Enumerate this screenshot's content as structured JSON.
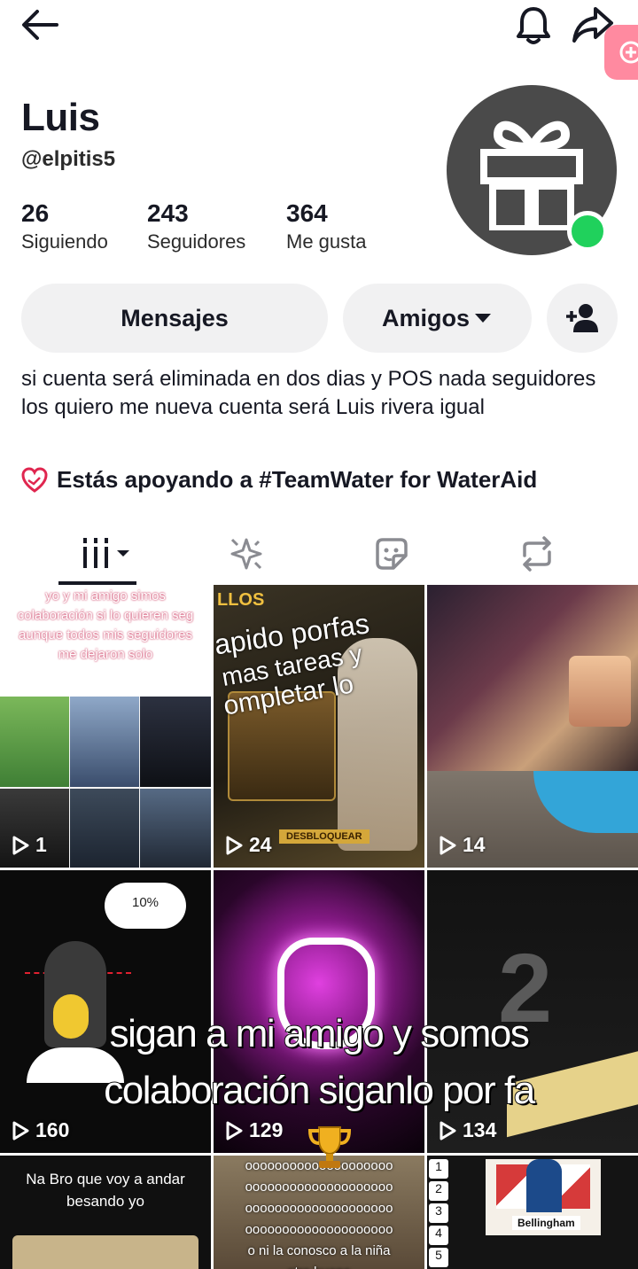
{
  "profile": {
    "name": "Luis",
    "handle": "@elpitis5",
    "stats": [
      {
        "value": "26",
        "label": "Siguiendo"
      },
      {
        "value": "243",
        "label": "Seguidores"
      },
      {
        "value": "364",
        "label": "Me gusta"
      }
    ],
    "avatar_icon": "gift-icon",
    "online": true
  },
  "actions": {
    "messages_label": "Mensajes",
    "friends_label": "Amigos"
  },
  "bio": "si cuenta será eliminada en dos dias y POS nada seguidores los quiero me nueva cuenta será Luis rivera igual",
  "support": {
    "text": "Estás apoyando a #TeamWater for WaterAid",
    "icon": "heart-hands-icon",
    "color": "#e0264f"
  },
  "tabs": [
    "videos-tab",
    "favorites-tab",
    "stickers-tab",
    "reposts-tab"
  ],
  "grid": [
    {
      "views": "1",
      "text_lines": [
        "yo y mi amigo simos",
        "colaboración si lo quieren seg",
        "aunque todos mis seguidores",
        "me dejaron solo"
      ]
    },
    {
      "views": "24",
      "text_lines": [
        "LLOS",
        "apido porfas",
        "mas tareas y",
        "ompletar lo"
      ],
      "badge": "DESBLOQUEAR"
    },
    {
      "views": "14",
      "text_lines": []
    },
    {
      "views": "160",
      "text_lines": [
        "10%"
      ]
    },
    {
      "views": "129",
      "text_lines": []
    },
    {
      "views": "134",
      "text_lines": [
        "2"
      ]
    },
    {
      "views": "",
      "text_lines": [
        "Na Bro que voy a andar",
        "besando yo"
      ]
    },
    {
      "views": "",
      "text_lines": [
        "oooooooooooooooooooo",
        "oooooooooooooooooooo",
        "oooooooooooooooooooo",
        "oooooooooooooooooooo",
        "o ni la conosco a la niña",
        "otro bueno"
      ]
    },
    {
      "views": "",
      "text_lines": [
        "1",
        "2",
        "3",
        "4",
        "5",
        "Bellingham"
      ]
    }
  ],
  "overlay_caption": [
    "sigan a mi amigo   y somos",
    "colaboración  siganlo por fa"
  ],
  "colors": {
    "accent": "#fe2c55",
    "online": "#20d15c",
    "pill_bg": "#f1f1f2"
  }
}
